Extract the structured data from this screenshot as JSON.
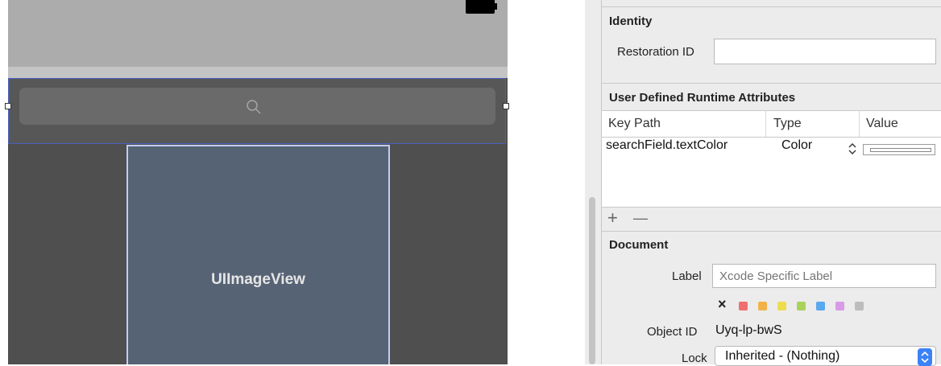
{
  "canvas": {
    "image_view_label": "UIImageView"
  },
  "identity": {
    "section_title": "Identity",
    "restoration_id_label": "Restoration ID",
    "restoration_id_value": ""
  },
  "runtime_attributes": {
    "section_title": "User Defined Runtime Attributes",
    "columns": [
      "Key Path",
      "Type",
      "Value"
    ],
    "rows": [
      {
        "key_path": "searchField.textColor",
        "type": "Color"
      }
    ],
    "add_label": "+",
    "remove_label": "—"
  },
  "document": {
    "section_title": "Document",
    "label_label": "Label",
    "label_placeholder": "Xcode Specific Label",
    "clear_label": "×",
    "label_colors": [
      "#ef6f6f",
      "#f2b24a",
      "#eedc4f",
      "#a9d25a",
      "#5aa8ee",
      "#d99be6",
      "#bdbdbd"
    ],
    "object_id_label": "Object ID",
    "object_id_value": "Uyq-lp-bwS",
    "lock_label": "Lock",
    "lock_value": "Inherited - (Nothing)"
  },
  "icons": {
    "search": "search-icon",
    "stepper": "stepper-icon",
    "popup_arrows": "popup-arrows-icon"
  }
}
